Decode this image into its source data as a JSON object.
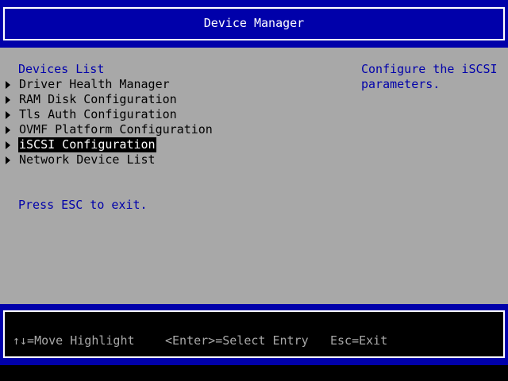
{
  "header": {
    "title": "Device Manager"
  },
  "main": {
    "section_title": "Devices List",
    "items": [
      {
        "label": "Driver Health Manager",
        "selected": false
      },
      {
        "label": "RAM Disk Configuration",
        "selected": false
      },
      {
        "label": "Tls Auth Configuration",
        "selected": false
      },
      {
        "label": "OVMF Platform Configuration",
        "selected": false
      },
      {
        "label": "iSCSI Configuration",
        "selected": true
      },
      {
        "label": "Network Device List",
        "selected": false
      }
    ],
    "hint": "Press ESC to exit."
  },
  "help": {
    "line1": "Configure the iSCSI",
    "line2": "parameters."
  },
  "footer": {
    "move": "↑↓=Move Highlight",
    "enter": "<Enter>=Select Entry",
    "esc": "Esc=Exit"
  },
  "colors": {
    "background": "#a8a8a8",
    "accent": "#0000aa",
    "selection": "#000000"
  },
  "icons": {
    "submenu": "submenu-arrow-icon"
  }
}
